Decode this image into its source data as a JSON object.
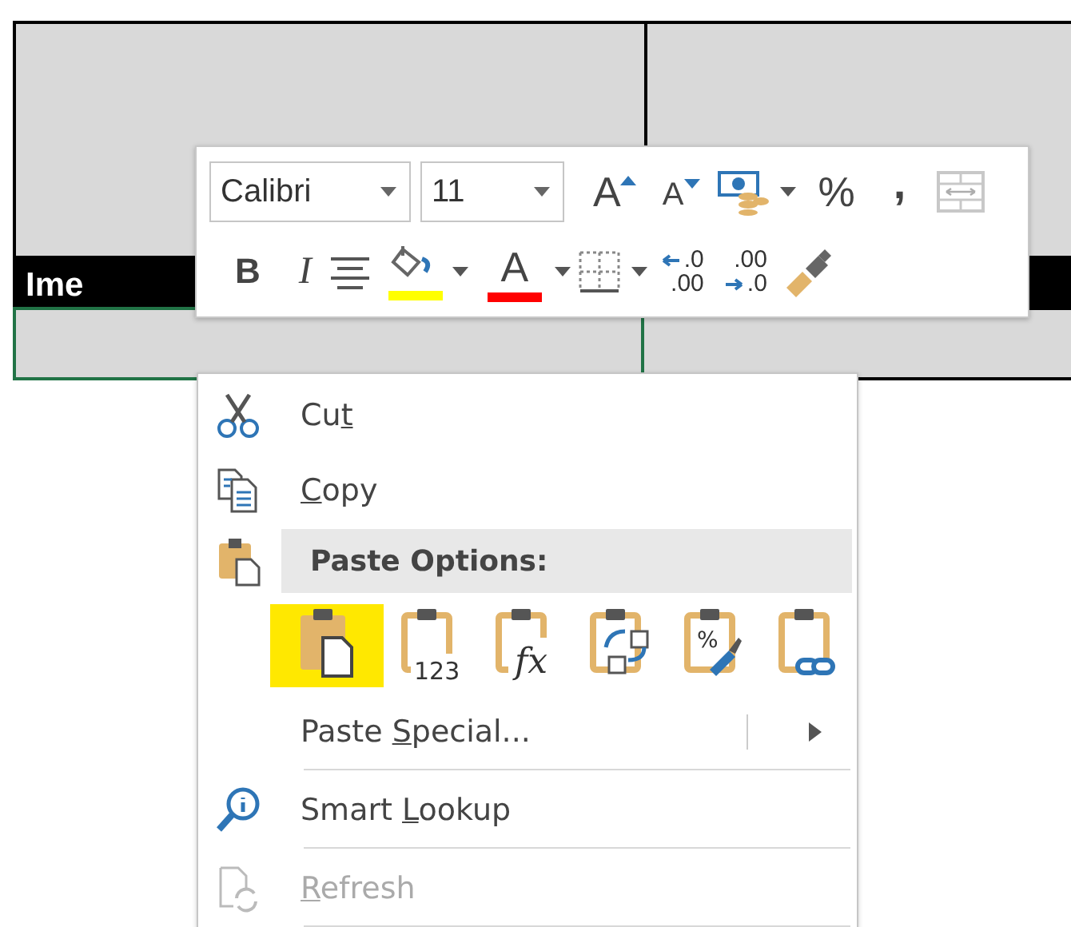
{
  "sheet": {
    "header_text": "Ime",
    "rows": [
      {
        "cells": [
          {
            "selected": true
          },
          {
            "selected": false
          }
        ]
      }
    ]
  },
  "mini_toolbar": {
    "font_name": {
      "value": "Calibri"
    },
    "font_size": {
      "value": "11"
    },
    "rows": [
      [
        {
          "kind": "grow-font",
          "glyph": "A"
        },
        {
          "kind": "shrink-font",
          "glyph": "A"
        },
        {
          "kind": "accounting",
          "dropdown": true
        },
        {
          "kind": "percent",
          "glyph": "%"
        },
        {
          "kind": "comma",
          "glyph": ","
        },
        {
          "kind": "merge",
          "disabled": true
        }
      ],
      [
        {
          "kind": "bold",
          "glyph": "B"
        },
        {
          "kind": "italic",
          "glyph": "I"
        },
        {
          "kind": "center"
        },
        {
          "kind": "fill-color",
          "color": "#ffff00",
          "dropdown": true
        },
        {
          "kind": "font-color",
          "glyph": "A",
          "color": "#ff0000",
          "dropdown": true
        },
        {
          "kind": "borders",
          "dropdown": true
        },
        {
          "kind": "increase-decimal",
          "glyph_top": ".0",
          "glyph_bottom": ".00"
        },
        {
          "kind": "decrease-decimal",
          "glyph_top": ".00",
          "glyph_bottom": ".0"
        },
        {
          "kind": "format-painter"
        }
      ]
    ]
  },
  "context_menu": {
    "items": [
      {
        "kind": "cut",
        "label": {
          "before": "Cu",
          "key": "t"
        }
      },
      {
        "kind": "copy",
        "label": {
          "key": "C",
          "after": "opy"
        }
      },
      {
        "kind": "header",
        "label": {
          "before": "Paste Options:"
        }
      },
      {
        "kind": "paste-options",
        "options": [
          {
            "kind": "paste",
            "selected": true
          },
          {
            "kind": "values",
            "glyph": "123",
            "selected": false
          },
          {
            "kind": "formulas",
            "glyph": "fx",
            "selected": false
          },
          {
            "kind": "transpose",
            "selected": false
          },
          {
            "kind": "formatting",
            "glyph": "%",
            "selected": false
          },
          {
            "kind": "link",
            "selected": false
          }
        ]
      },
      {
        "kind": "paste-special",
        "label": {
          "before": "Paste ",
          "key": "S",
          "after": "pecial..."
        },
        "submenu": true,
        "separator_after": true
      },
      {
        "kind": "smart-lookup",
        "label": {
          "before": "Smart ",
          "key": "L",
          "after": "ookup"
        },
        "separator_after": true
      },
      {
        "kind": "refresh",
        "label": {
          "key": "R",
          "after": "efresh"
        },
        "disabled": true,
        "separator_after": true
      }
    ]
  }
}
